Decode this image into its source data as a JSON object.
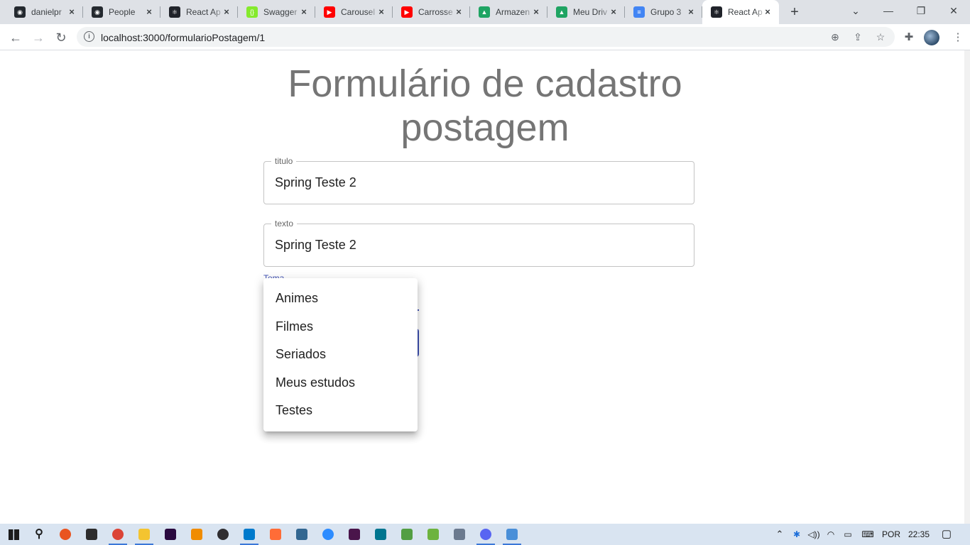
{
  "browser": {
    "tabs": [
      {
        "title": "danielpr",
        "icon": "github-icon",
        "color": "#24292f",
        "glyph": "◉"
      },
      {
        "title": "People",
        "icon": "github-icon",
        "color": "#24292f",
        "glyph": "◉"
      },
      {
        "title": "React Ap",
        "icon": "react-icon",
        "color": "#20232a",
        "glyph": "⚛"
      },
      {
        "title": "Swagger",
        "icon": "swagger-icon",
        "color": "#85ea2d",
        "glyph": "{}"
      },
      {
        "title": "Carousel",
        "icon": "youtube-icon",
        "color": "#ff0000",
        "glyph": "▶"
      },
      {
        "title": "Carrosse",
        "icon": "youtube-icon",
        "color": "#ff0000",
        "glyph": "▶"
      },
      {
        "title": "Armazen",
        "icon": "google-drive-icon",
        "color": "#1fa463",
        "glyph": "▲"
      },
      {
        "title": "Meu Driv",
        "icon": "google-drive-icon",
        "color": "#1fa463",
        "glyph": "▲"
      },
      {
        "title": "Grupo 3",
        "icon": "google-docs-icon",
        "color": "#4285f4",
        "glyph": "≡"
      },
      {
        "title": "React Ap",
        "icon": "react-icon",
        "color": "#20232a",
        "glyph": "⚛",
        "active": true
      }
    ],
    "url": "localhost:3000/formularioPostagem/1"
  },
  "form": {
    "title": "Formulário de cadastro postagem",
    "titulo_label": "titulo",
    "titulo_value": "Spring Teste 2",
    "texto_label": "texto",
    "texto_value": "Spring Teste 2",
    "tema_label": "Tema",
    "accent_color": "#3f51b5"
  },
  "tema_menu": {
    "options": [
      "Animes",
      "Filmes",
      "Seriados",
      "Meus estudos",
      "Testes"
    ]
  },
  "taskbar": {
    "apps": [
      {
        "name": "windows-start-icon"
      },
      {
        "name": "search-icon"
      },
      {
        "name": "ubuntu-icon",
        "color": "#e95420"
      },
      {
        "name": "terminal-icon",
        "color": "#2d2d2d"
      },
      {
        "name": "chrome-icon",
        "color": "#db4437",
        "running": true
      },
      {
        "name": "file-explorer-icon",
        "color": "#f4c430",
        "running": true
      },
      {
        "name": "premiere-icon",
        "color": "#2a0a3f"
      },
      {
        "name": "vlc-icon",
        "color": "#f08c00"
      },
      {
        "name": "obs-icon",
        "color": "#302e31"
      },
      {
        "name": "vscode-icon",
        "color": "#007acc",
        "running": true
      },
      {
        "name": "postman-icon",
        "color": "#ff6c37"
      },
      {
        "name": "postgres-icon",
        "color": "#336791"
      },
      {
        "name": "zoom-icon",
        "color": "#2d8cff"
      },
      {
        "name": "slack-icon",
        "color": "#4a154b"
      },
      {
        "name": "mysql-workbench-icon",
        "color": "#00758f"
      },
      {
        "name": "nodejs-icon",
        "color": "#539e43"
      },
      {
        "name": "spring-icon",
        "color": "#6db33f"
      },
      {
        "name": "dbeaver-icon",
        "color": "#6b7a8f"
      },
      {
        "name": "discord-icon",
        "color": "#5865f2",
        "running": true
      },
      {
        "name": "notepad-icon",
        "color": "#4a8fd8",
        "running": true
      }
    ],
    "language": "POR",
    "time": "22:35"
  }
}
